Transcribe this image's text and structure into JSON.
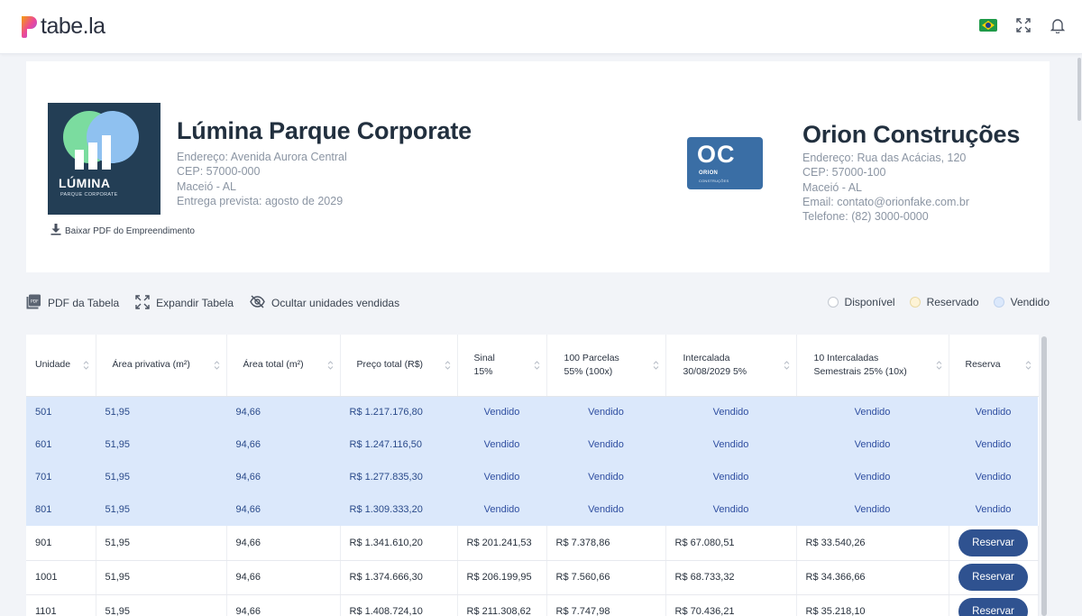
{
  "app": {
    "logo_text": "tabe.la",
    "flag_icon": "brazil-flag-icon"
  },
  "project": {
    "logo_brand": "LÚMINA",
    "logo_sub": "PARQUE CORPORATE",
    "title": "Lúmina Parque Corporate",
    "address": "Endereço: Avenida Aurora Central",
    "cep": "CEP: 57000-000",
    "city": "Maceió - AL",
    "delivery": "Entrega prevista: agosto de 2029",
    "pdf_link": "Baixar PDF do Empreendimento"
  },
  "constructor": {
    "logo_big": "OC",
    "logo_name": "ORION",
    "logo_sub": "CONSTRUÇÕES",
    "title": "Orion Construções",
    "address": "Endereço: Rua das Acácias, 120",
    "cep": "CEP: 57000-100",
    "city": "Maceió - AL",
    "email": "Email: contato@orionfake.com.br",
    "phone": "Telefone: (82) 3000-0000"
  },
  "toolbar": {
    "pdf_table": "PDF da Tabela",
    "expand_table": "Expandir Tabela",
    "hide_sold": "Ocultar unidades vendidas"
  },
  "legend": {
    "available": "Disponível",
    "reserved": "Reservado",
    "sold": "Vendido",
    "colors": {
      "available": "#ffffff",
      "reserved": "#fdf3d6",
      "sold": "#dbe8fb"
    }
  },
  "table": {
    "headers": {
      "unit": "Unidade",
      "private_area": "Área privativa (m²)",
      "total_area": "Área total (m²)",
      "total_price": "Preço total (R$)",
      "signal_1": "Sinal",
      "signal_2": "15%",
      "parcels_1": "100 Parcelas",
      "parcels_2": "55% (100x)",
      "inter_1": "Intercalada",
      "inter_2": "30/08/2029 5%",
      "semi_1": "10 Intercaladas",
      "semi_2": "Semestrais 25% (10x)",
      "reserve": "Reserva"
    },
    "sold_label": "Vendido",
    "reserve_label": "Reservar",
    "sold_rows": [
      {
        "unit": "501",
        "private_area": "51,95",
        "total_area": "94,66",
        "price": "R$ 1.217.176,80"
      },
      {
        "unit": "601",
        "private_area": "51,95",
        "total_area": "94,66",
        "price": "R$ 1.247.116,50"
      },
      {
        "unit": "701",
        "private_area": "51,95",
        "total_area": "94,66",
        "price": "R$ 1.277.835,30"
      },
      {
        "unit": "801",
        "private_area": "51,95",
        "total_area": "94,66",
        "price": "R$ 1.309.333,20"
      }
    ],
    "available_rows": [
      {
        "unit": "901",
        "private_area": "51,95",
        "total_area": "94,66",
        "price": "R$ 1.341.610,20",
        "signal": "R$ 201.241,53",
        "parcel": "R$ 7.378,86",
        "inter": "R$ 67.080,51",
        "semi": "R$ 33.540,26"
      },
      {
        "unit": "1001",
        "private_area": "51,95",
        "total_area": "94,66",
        "price": "R$ 1.374.666,30",
        "signal": "R$ 206.199,95",
        "parcel": "R$ 7.560,66",
        "inter": "R$ 68.733,32",
        "semi": "R$ 34.366,66"
      },
      {
        "unit": "1101",
        "private_area": "51,95",
        "total_area": "94,66",
        "price": "R$ 1.408.724,10",
        "signal": "R$ 211.308,62",
        "parcel": "R$ 7.747,98",
        "inter": "R$ 70.436,21",
        "semi": "R$ 35.218,10"
      }
    ]
  }
}
